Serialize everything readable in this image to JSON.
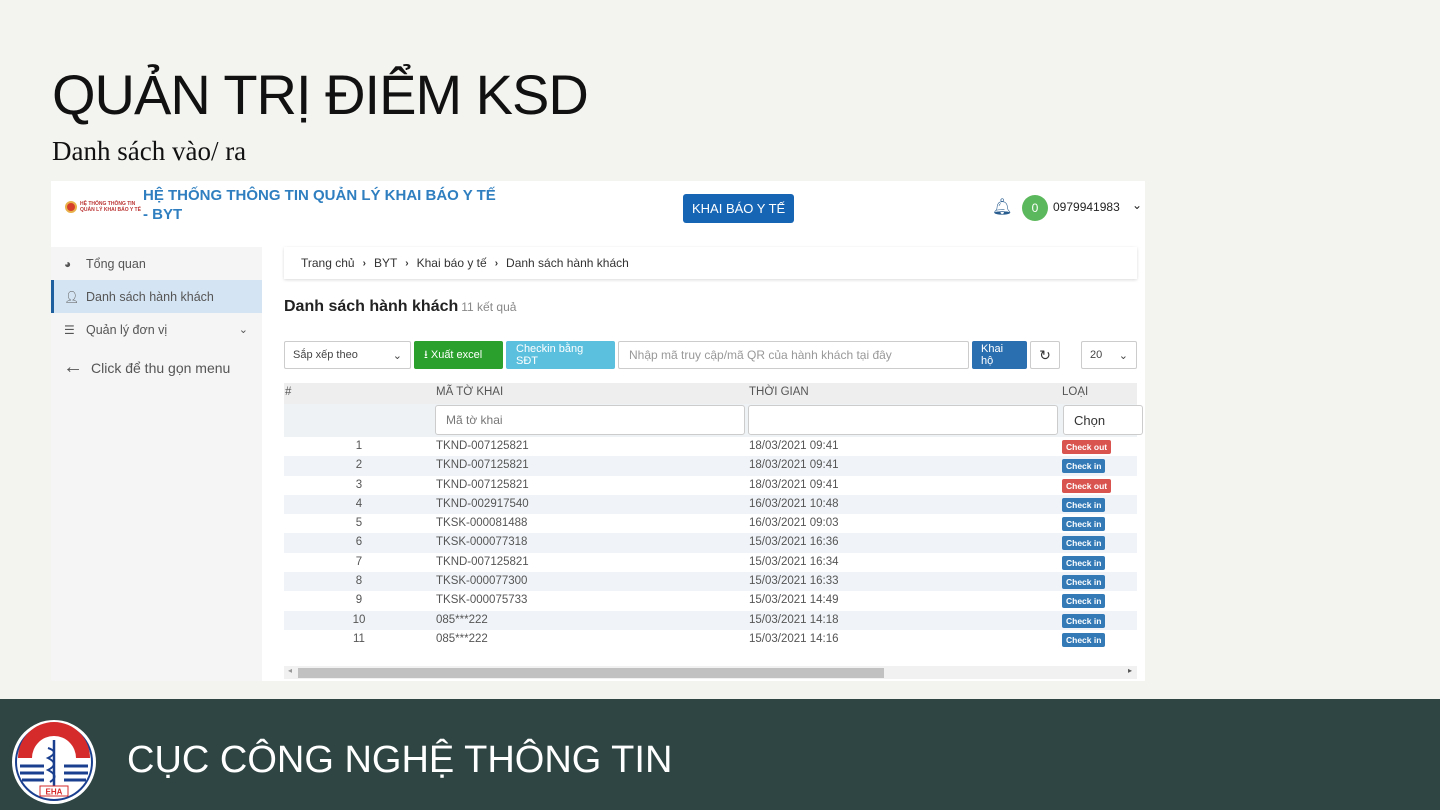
{
  "slide": {
    "title": "QUẢN TRỊ ĐIỂM KSD",
    "subtitle": "Danh sách vào/ ra",
    "footer_org": "CỤC CÔNG NGHỆ THÔNG TIN",
    "footer_logo_text": "EHA"
  },
  "app": {
    "logo_text": [
      "HỆ THỐNG THÔNG TIN",
      "QUẢN LÝ KHAI BÁO Y TẾ"
    ],
    "title_line1": "HỆ THỐNG THÔNG TIN QUẢN LÝ KHAI BÁO Y TẾ",
    "title_line2": "- BYT",
    "khai_bao_button": "KHAI BÁO Y TẾ",
    "notifications": "0",
    "user": "0979941983",
    "sidebar": {
      "items": [
        {
          "label": "Tổng quan",
          "icon": "dashboard-icon"
        },
        {
          "label": "Danh sách hành khách",
          "icon": "user-icon",
          "active": true
        },
        {
          "label": "Quản lý đơn vị",
          "icon": "list-icon"
        }
      ],
      "collapse": "Click để thu gọn menu"
    },
    "breadcrumb": [
      "Trang chủ",
      "BYT",
      "Khai báo y tế",
      "Danh sách hành khách"
    ],
    "page_title": "Danh sách hành khách",
    "result_count": "11 kết quả",
    "toolbar": {
      "sort": "Sắp xếp theo",
      "export": "Xuất excel",
      "checkin_phone": "Checkin bằng SĐT",
      "search_placeholder": "Nhập mã truy cập/mã QR của hành khách tại đây",
      "khai_ho": "Khai hộ",
      "page_size": "20"
    },
    "table": {
      "columns": [
        "#",
        "MÃ TỜ KHAI",
        "THỜI GIAN",
        "LOẠI"
      ],
      "filters": {
        "code_placeholder": "Mã tờ khai",
        "time": "",
        "type": "Chọn"
      },
      "rows": [
        {
          "n": "1",
          "code": "TKND-007125821",
          "time": "18/03/2021 09:41",
          "type": "Check out"
        },
        {
          "n": "2",
          "code": "TKND-007125821",
          "time": "18/03/2021 09:41",
          "type": "Check in"
        },
        {
          "n": "3",
          "code": "TKND-007125821",
          "time": "18/03/2021 09:41",
          "type": "Check out"
        },
        {
          "n": "4",
          "code": "TKND-002917540",
          "time": "16/03/2021 10:48",
          "type": "Check in"
        },
        {
          "n": "5",
          "code": "TKSK-000081488",
          "time": "16/03/2021 09:03",
          "type": "Check in"
        },
        {
          "n": "6",
          "code": "TKSK-000077318",
          "time": "15/03/2021 16:36",
          "type": "Check in"
        },
        {
          "n": "7",
          "code": "TKND-007125821",
          "time": "15/03/2021 16:34",
          "type": "Check in"
        },
        {
          "n": "8",
          "code": "TKSK-000077300",
          "time": "15/03/2021 16:33",
          "type": "Check in"
        },
        {
          "n": "9",
          "code": "TKSK-000075733",
          "time": "15/03/2021 14:49",
          "type": "Check in"
        },
        {
          "n": "10",
          "code": "085***222",
          "time": "15/03/2021 14:18",
          "type": "Check in"
        },
        {
          "n": "11",
          "code": "085***222",
          "time": "15/03/2021 14:16",
          "type": "Check in"
        }
      ]
    }
  },
  "colors": {
    "checkin": "#337ab7",
    "checkout": "#d9534f",
    "footer": "#2e4543",
    "primary": "#1665b5"
  }
}
